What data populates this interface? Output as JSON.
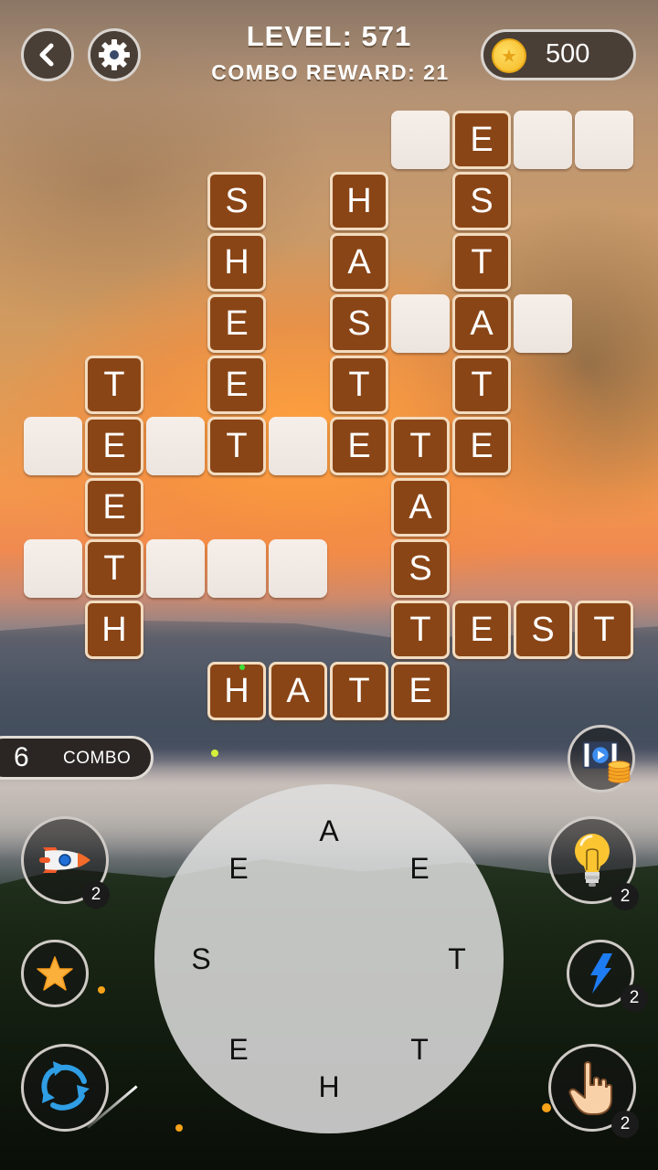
{
  "header": {
    "back_icon": "chevron-left-icon",
    "settings_icon": "gear-icon",
    "level_label": "LEVEL: 571",
    "combo_reward_label": "COMBO REWARD: 21",
    "coins": "500",
    "coin_icon": "star-coin-icon"
  },
  "grid": {
    "cells": [
      {
        "row": 0,
        "col": 6,
        "letter": ""
      },
      {
        "row": 0,
        "col": 7,
        "letter": "E"
      },
      {
        "row": 0,
        "col": 8,
        "letter": ""
      },
      {
        "row": 0,
        "col": 9,
        "letter": ""
      },
      {
        "row": 1,
        "col": 3,
        "letter": "S"
      },
      {
        "row": 1,
        "col": 5,
        "letter": "H"
      },
      {
        "row": 1,
        "col": 7,
        "letter": "S"
      },
      {
        "row": 2,
        "col": 3,
        "letter": "H"
      },
      {
        "row": 2,
        "col": 5,
        "letter": "A"
      },
      {
        "row": 2,
        "col": 7,
        "letter": "T"
      },
      {
        "row": 3,
        "col": 3,
        "letter": "E"
      },
      {
        "row": 3,
        "col": 5,
        "letter": "S"
      },
      {
        "row": 3,
        "col": 6,
        "letter": ""
      },
      {
        "row": 3,
        "col": 7,
        "letter": "A"
      },
      {
        "row": 3,
        "col": 8,
        "letter": ""
      },
      {
        "row": 4,
        "col": 1,
        "letter": "T"
      },
      {
        "row": 4,
        "col": 3,
        "letter": "E"
      },
      {
        "row": 4,
        "col": 5,
        "letter": "T"
      },
      {
        "row": 4,
        "col": 7,
        "letter": "T"
      },
      {
        "row": 5,
        "col": 0,
        "letter": ""
      },
      {
        "row": 5,
        "col": 1,
        "letter": "E"
      },
      {
        "row": 5,
        "col": 2,
        "letter": ""
      },
      {
        "row": 5,
        "col": 3,
        "letter": "T"
      },
      {
        "row": 5,
        "col": 4,
        "letter": ""
      },
      {
        "row": 5,
        "col": 5,
        "letter": "E"
      },
      {
        "row": 5,
        "col": 6,
        "letter": "T"
      },
      {
        "row": 5,
        "col": 7,
        "letter": "E"
      },
      {
        "row": 6,
        "col": 1,
        "letter": "E"
      },
      {
        "row": 6,
        "col": 6,
        "letter": "A"
      },
      {
        "row": 7,
        "col": 0,
        "letter": ""
      },
      {
        "row": 7,
        "col": 1,
        "letter": "T"
      },
      {
        "row": 7,
        "col": 2,
        "letter": ""
      },
      {
        "row": 7,
        "col": 3,
        "letter": ""
      },
      {
        "row": 7,
        "col": 4,
        "letter": ""
      },
      {
        "row": 7,
        "col": 6,
        "letter": "S"
      },
      {
        "row": 8,
        "col": 1,
        "letter": "H"
      },
      {
        "row": 8,
        "col": 6,
        "letter": "T"
      },
      {
        "row": 8,
        "col": 7,
        "letter": "E"
      },
      {
        "row": 8,
        "col": 8,
        "letter": "S"
      },
      {
        "row": 8,
        "col": 9,
        "letter": "T"
      },
      {
        "row": 9,
        "col": 3,
        "letter": "H"
      },
      {
        "row": 9,
        "col": 4,
        "letter": "A"
      },
      {
        "row": 9,
        "col": 5,
        "letter": "T"
      },
      {
        "row": 9,
        "col": 6,
        "letter": "E"
      }
    ]
  },
  "combo": {
    "count": "6",
    "label": "COMBO"
  },
  "powerups": {
    "video_reward": {
      "icon": "video-coins-icon"
    },
    "rocket": {
      "icon": "rocket-icon",
      "count": "2"
    },
    "hint": {
      "icon": "lightbulb-icon",
      "count": "2"
    },
    "star": {
      "icon": "star-icon"
    },
    "lightning": {
      "icon": "lightning-icon",
      "count": "2"
    },
    "shuffle": {
      "icon": "shuffle-icon"
    },
    "finger": {
      "icon": "pointing-hand-icon",
      "count": "2"
    }
  },
  "wheel": {
    "letters": [
      "A",
      "E",
      "T",
      "T",
      "H",
      "E",
      "S",
      "E"
    ]
  }
}
